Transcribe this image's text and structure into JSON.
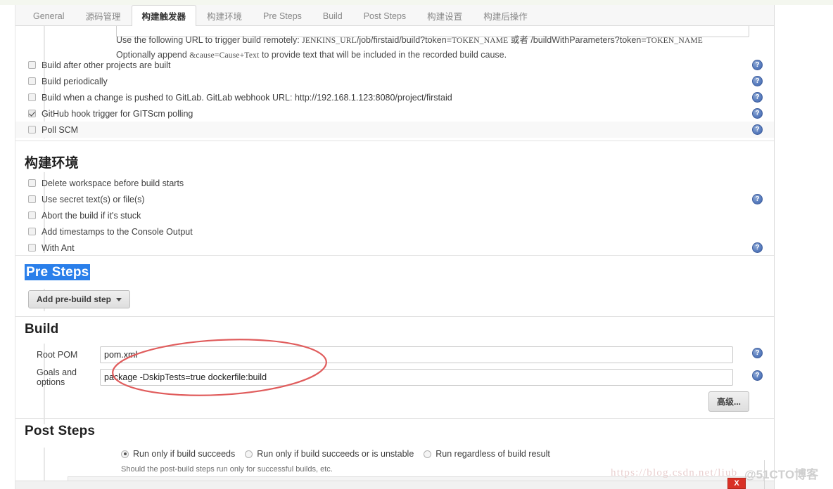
{
  "tabs": [
    {
      "label": "General",
      "active": false
    },
    {
      "label": "源码管理",
      "active": false
    },
    {
      "label": "构建触发器",
      "active": true
    },
    {
      "label": "构建环境",
      "active": false
    },
    {
      "label": "Pre Steps",
      "active": false
    },
    {
      "label": "Build",
      "active": false
    },
    {
      "label": "Post Steps",
      "active": false
    },
    {
      "label": "构建设置",
      "active": false
    },
    {
      "label": "构建后操作",
      "active": false
    }
  ],
  "notice": {
    "line1_a": "Use the following URL to trigger build remotely: ",
    "line1_mono1": "JENKINS_URL",
    "line1_b": "/job/firstaid/build?token=",
    "line1_mono2": "TOKEN_NAME",
    "line1_c": " 或者 /buildWithParameters?token=",
    "line1_mono3": "TOKEN_NAME",
    "line2_a": "Optionally append ",
    "line2_mono": "&cause=Cause+Text",
    "line2_b": " to provide text that will be included in the recorded build cause."
  },
  "triggers": [
    {
      "label": "Build after other projects are built",
      "checked": false,
      "shaded": false,
      "help": true
    },
    {
      "label": "Build periodically",
      "checked": false,
      "shaded": false,
      "help": true
    },
    {
      "label": "Build when a change is pushed to GitLab. GitLab webhook URL: http://192.168.1.123:8080/project/firstaid",
      "checked": false,
      "shaded": false,
      "help": true
    },
    {
      "label": "GitHub hook trigger for GITScm polling",
      "checked": true,
      "shaded": false,
      "help": true
    },
    {
      "label": "Poll SCM",
      "checked": false,
      "shaded": true,
      "help": true
    }
  ],
  "build_env": {
    "title": "构建环境",
    "items": [
      {
        "label": "Delete workspace before build starts",
        "checked": false,
        "help": false
      },
      {
        "label": "Use secret text(s) or file(s)",
        "checked": false,
        "help": true
      },
      {
        "label": "Abort the build if it's stuck",
        "checked": false,
        "help": false
      },
      {
        "label": "Add timestamps to the Console Output",
        "checked": false,
        "help": false
      },
      {
        "label": "With Ant",
        "checked": false,
        "help": true
      }
    ]
  },
  "pre_steps": {
    "title": "Pre Steps",
    "add_button": "Add pre-build step"
  },
  "build": {
    "title": "Build",
    "root_pom_label": "Root POM",
    "root_pom_value": "pom.xml",
    "goals_label": "Goals and options",
    "goals_value": "package -DskipTests=true dockerfile:build",
    "advanced_button": "高级..."
  },
  "post_steps": {
    "title": "Post Steps",
    "options": [
      {
        "label": "Run only if build succeeds",
        "selected": true
      },
      {
        "label": "Run only if build succeeds or is unstable",
        "selected": false
      },
      {
        "label": "Run regardless of build result",
        "selected": false
      }
    ],
    "hint": "Should the post-build steps run only for successful builds, etc."
  },
  "watermark": {
    "url": "https://blog.csdn.net/liub",
    "brand": "@51CTO博客"
  },
  "close_button": "X",
  "colors": {
    "accent_blue": "#2a7fea",
    "help_blue": "#5b7fc0",
    "annotation_red": "#e05c5c",
    "close_red": "#d93025"
  }
}
